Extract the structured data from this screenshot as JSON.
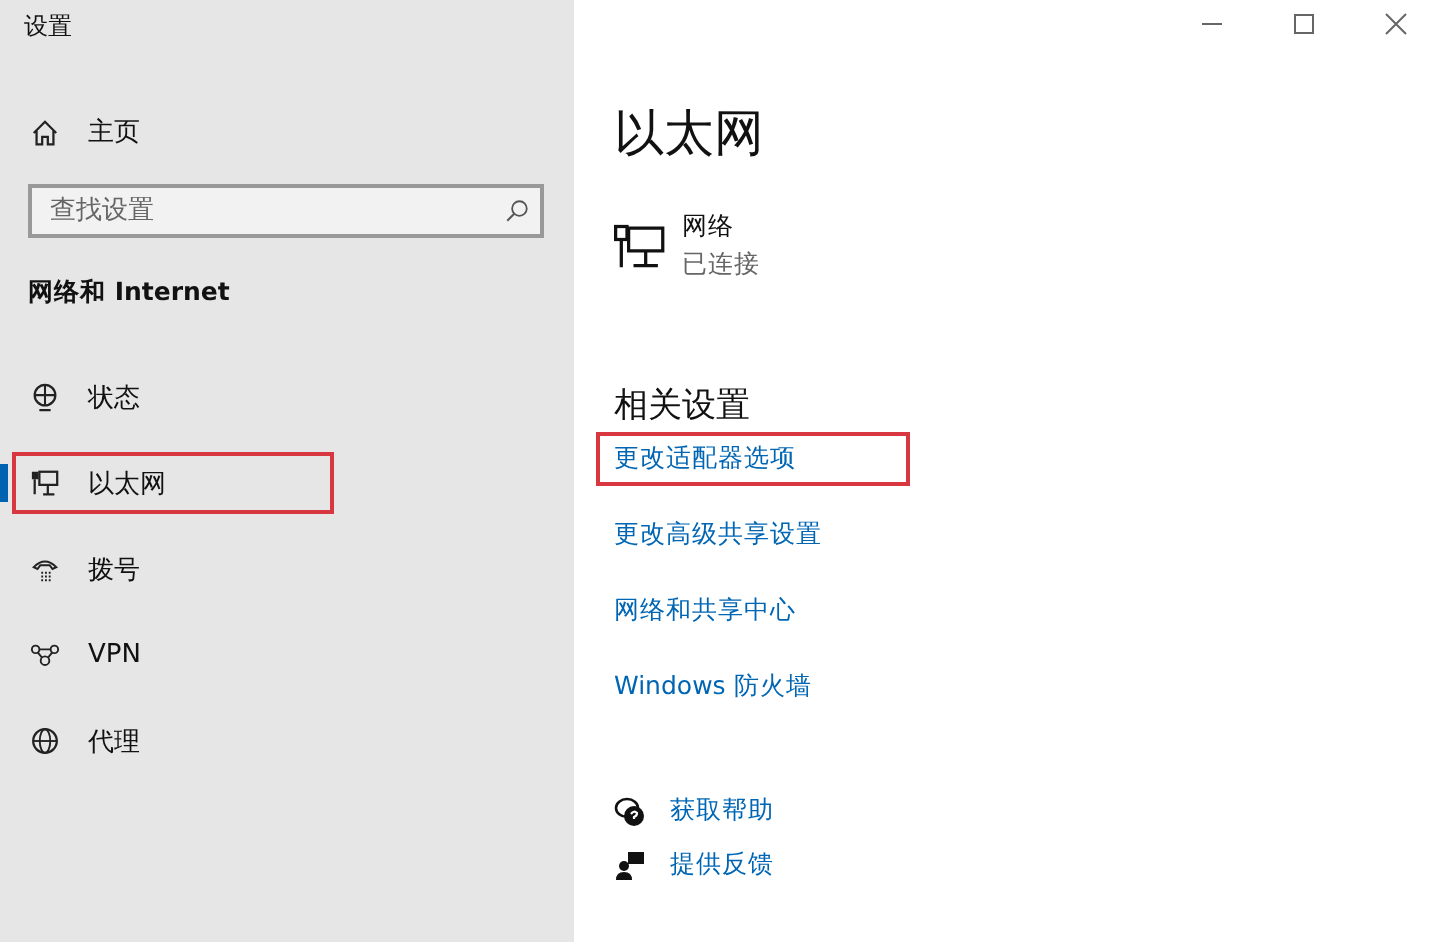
{
  "window": {
    "title": "设置"
  },
  "sidebar": {
    "home": "主页",
    "search": {
      "placeholder": "查找设置"
    },
    "section": "网络和 Internet",
    "items": [
      {
        "label": "状态",
        "selected": false,
        "highlighted": false
      },
      {
        "label": "以太网",
        "selected": true,
        "highlighted": true
      },
      {
        "label": "拨号",
        "selected": false,
        "highlighted": false
      },
      {
        "label": "VPN",
        "selected": false,
        "highlighted": false
      },
      {
        "label": "代理",
        "selected": false,
        "highlighted": false
      }
    ]
  },
  "main": {
    "title": "以太网",
    "network": {
      "name": "网络",
      "status": "已连接"
    },
    "related_title": "相关设置",
    "links": [
      {
        "label": "更改适配器选项",
        "highlighted": true
      },
      {
        "label": "更改高级共享设置",
        "highlighted": false
      },
      {
        "label": "网络和共享中心",
        "highlighted": false
      },
      {
        "label": "Windows 防火墙",
        "highlighted": false
      }
    ],
    "help": [
      "获取帮助",
      "提供反馈"
    ]
  }
}
